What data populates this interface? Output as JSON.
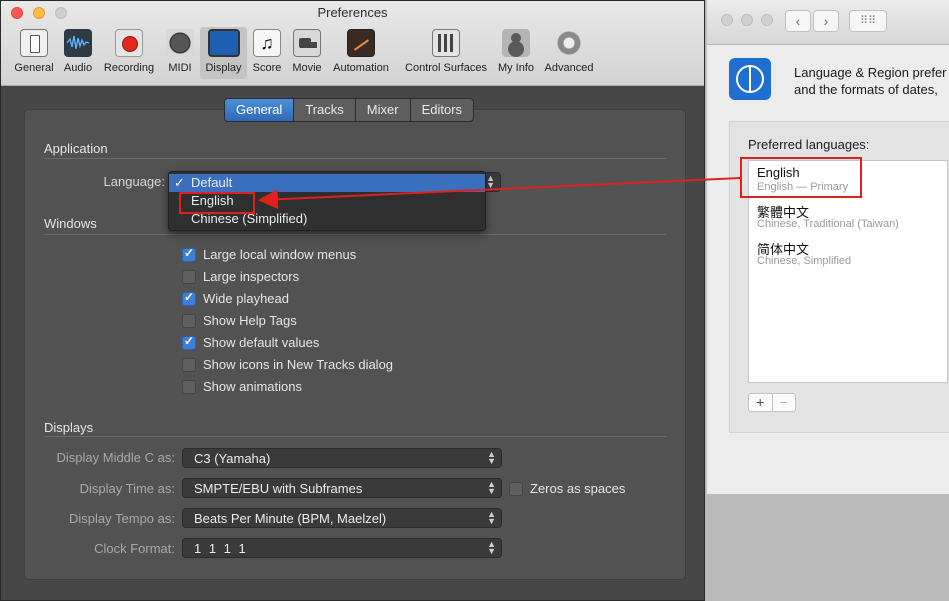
{
  "prefs": {
    "title": "Preferences",
    "toolbar": [
      {
        "label": "General",
        "icon": "general-icon"
      },
      {
        "label": "Audio",
        "icon": "audio-icon"
      },
      {
        "label": "Recording",
        "icon": "recording-icon"
      },
      {
        "label": "MIDI",
        "icon": "midi-icon"
      },
      {
        "label": "Display",
        "icon": "display-icon",
        "active": true
      },
      {
        "label": "Score",
        "icon": "score-icon"
      },
      {
        "label": "Movie",
        "icon": "movie-icon"
      },
      {
        "label": "Automation",
        "icon": "automation-icon"
      },
      {
        "label": "Control Surfaces",
        "icon": "control-surfaces-icon"
      },
      {
        "label": "My Info",
        "icon": "my-info-icon"
      },
      {
        "label": "Advanced",
        "icon": "advanced-icon"
      }
    ],
    "tabs": [
      "General",
      "Tracks",
      "Mixer",
      "Editors"
    ],
    "selected_tab": "General",
    "application": {
      "title": "Application",
      "language_label": "Language:",
      "menu_items": [
        "Default",
        "English",
        "Chinese (Simplified)"
      ],
      "checked_item": "Default"
    },
    "windows": {
      "title": "Windows",
      "options": [
        {
          "label": "Large local window menus",
          "checked": true
        },
        {
          "label": "Large inspectors",
          "checked": false
        },
        {
          "label": "Wide playhead",
          "checked": true
        },
        {
          "label": "Show Help Tags",
          "checked": false
        },
        {
          "label": "Show default values",
          "checked": true
        },
        {
          "label": "Show icons in New Tracks dialog",
          "checked": false
        },
        {
          "label": "Show animations",
          "checked": false
        }
      ]
    },
    "displays": {
      "title": "Displays",
      "middle_c_label": "Display Middle C as:",
      "middle_c_value": "C3 (Yamaha)",
      "time_label": "Display Time as:",
      "time_value": "SMPTE/EBU with Subframes",
      "zeros_label": "Zeros as spaces",
      "zeros_checked": false,
      "tempo_label": "Display Tempo as:",
      "tempo_value": "Beats Per Minute (BPM, Maelzel)",
      "clock_label": "Clock Format:",
      "clock_value": "1 1 1 1"
    }
  },
  "system": {
    "description_line1": "Language & Region prefer",
    "description_line2": "and the formats of dates,",
    "preferred_title": "Preferred languages:",
    "languages": [
      {
        "name": "English",
        "sub": "English — Primary"
      },
      {
        "name": "繁體中文",
        "sub": "Chinese, Traditional (Taiwan)"
      },
      {
        "name": "简体中文",
        "sub": "Chinese, Simplified"
      }
    ],
    "add_label": "+",
    "remove_label": "−",
    "nav_back": "‹",
    "nav_forward": "›",
    "grid_label": "⠿⠿"
  },
  "colors": {
    "highlight_box": "#e2201b",
    "accent": "#3d7fd6"
  }
}
